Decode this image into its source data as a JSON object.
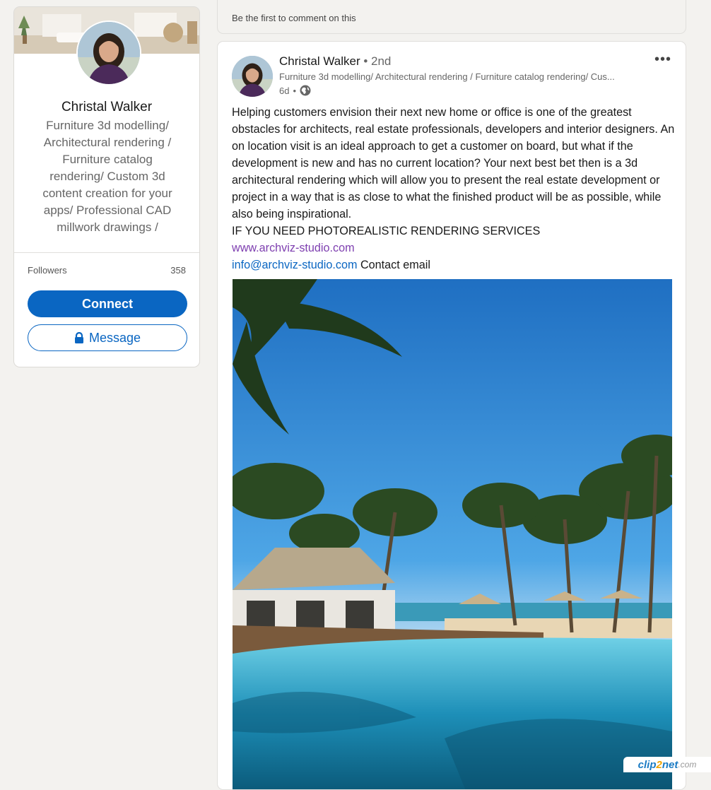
{
  "comment_card": {
    "text": "Be the first to comment on this"
  },
  "profile": {
    "name": "Christal Walker",
    "headline": "Furniture 3d modelling/ Architectural rendering / Furniture catalog rendering/ Custom 3d content creation for your apps/ Professional CAD millwork drawings /",
    "followers_label": "Followers",
    "followers_count": "358",
    "connect_label": "Connect",
    "message_label": "Message"
  },
  "post": {
    "author_name": "Christal Walker",
    "author_degree": "• 2nd",
    "author_headline": "Furniture 3d modelling/ Architectural rendering / Furniture catalog rendering/ Cus...",
    "time": "6d",
    "time_separator": "•",
    "more_label": "•••",
    "body": "Helping customers envision their next new home or office is one of the greatest obstacles for architects, real estate professionals, developers and interior designers. An on location visit is an ideal approach to get a customer on board, but what if the development is new and has no current location? Your next best bet then is a 3d architectural rendering which will allow you to present the real estate development or project in a way that is as close to what the finished product will be as possible, while also being inspirational.",
    "cta": "IF YOU NEED PHOTOREALISTIC RENDERING SERVICES",
    "website": "www.archviz-studio.com",
    "email": "info@archviz-studio.com",
    "email_suffix": " Contact email"
  },
  "watermark": {
    "part1": "clip",
    "part2": "2",
    "part3": "net",
    "part4": ".com"
  },
  "colors": {
    "brand_blue": "#0a66c2",
    "visited_link": "#7e3fb0",
    "background": "#f3f2ef"
  },
  "icons": [
    "lock-icon",
    "globe-icon",
    "more-options-icon"
  ]
}
